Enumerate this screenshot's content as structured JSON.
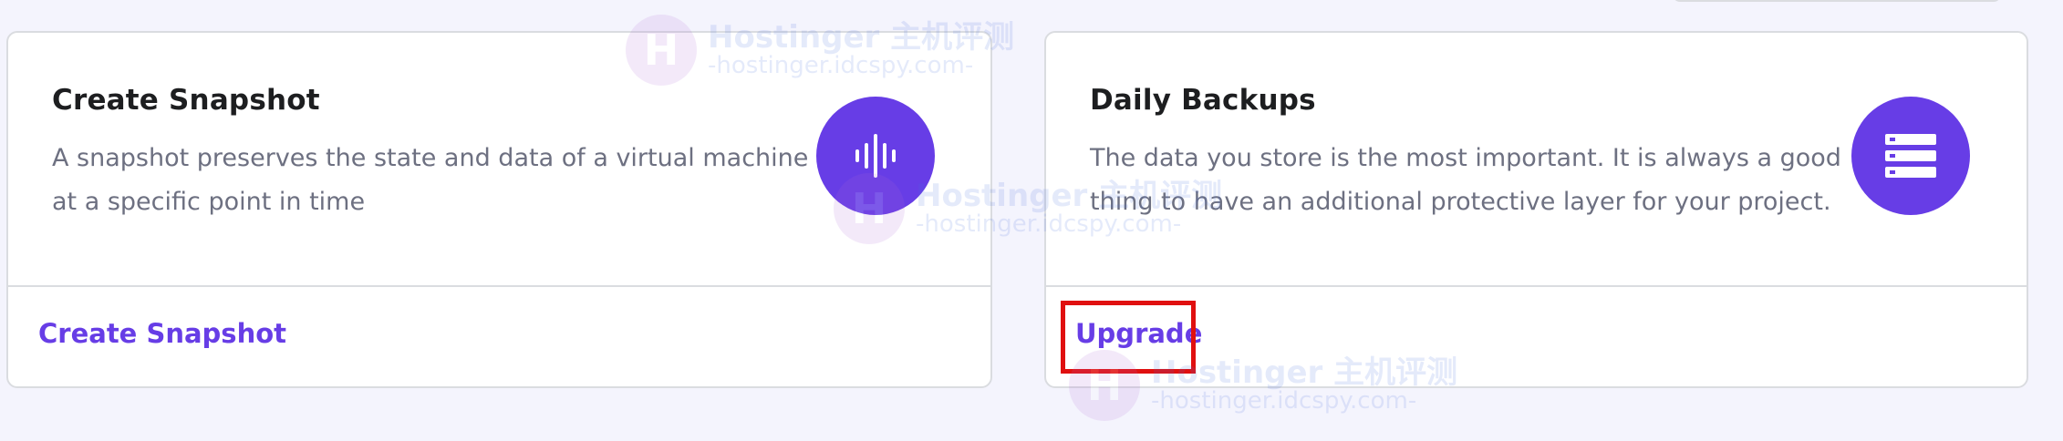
{
  "cards": [
    {
      "title": "Create Snapshot",
      "description": "A snapshot preserves the state and data of a virtual machine at a specific point in time",
      "icon": "waveform-icon",
      "action_label": "Create Snapshot"
    },
    {
      "title": "Daily Backups",
      "description": "The data you store is the most important. It is always a good thing to have an additional protective layer for your project.",
      "icon": "server-stack-icon",
      "action_label": "Upgrade"
    }
  ],
  "watermark": {
    "logo_letter": "H",
    "main": "Hostinger 主机评测",
    "sub": "-hostinger.idcspy.com-"
  },
  "colors": {
    "accent": "#673de6",
    "highlight": "#e01010",
    "background": "#f4f4fd"
  }
}
